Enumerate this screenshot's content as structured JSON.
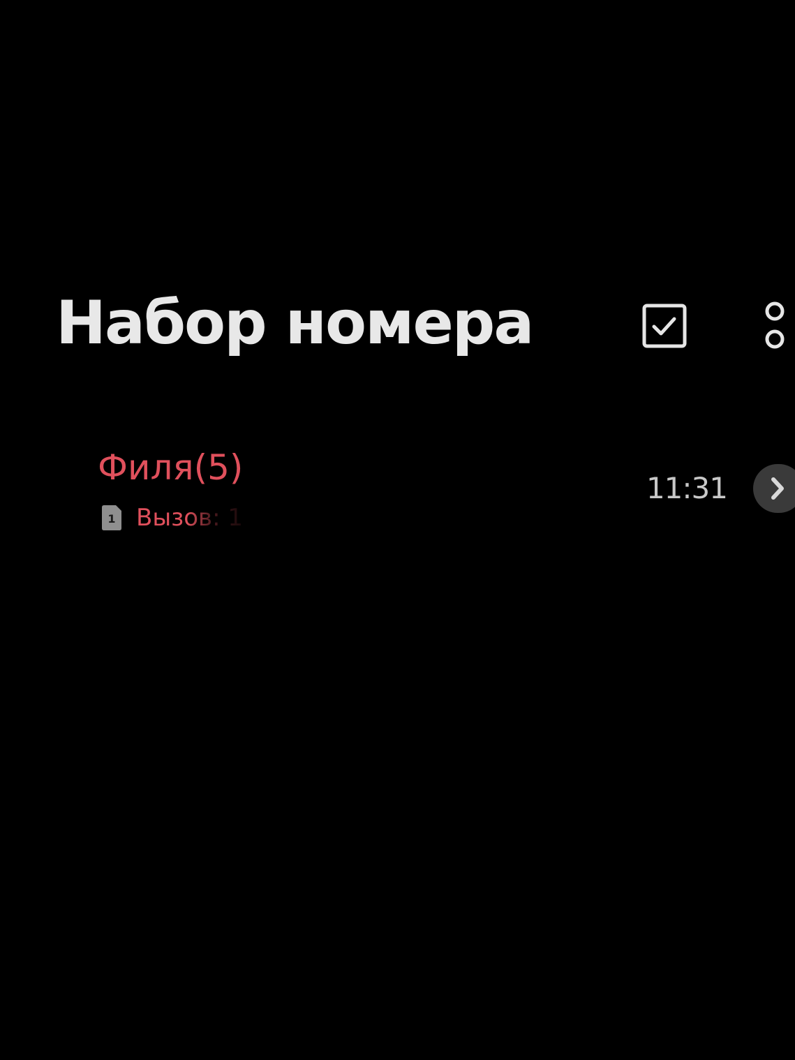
{
  "header": {
    "title": "Набор номера",
    "select_icon": "checkbox-checked-icon",
    "more_icon": "more-vertical-icon"
  },
  "recents": [
    {
      "name": "Филя(5)",
      "sim_icon": "sim-1-icon",
      "sim_slot": "1",
      "call_type": "Вызов: 1",
      "time": "11:31",
      "details_icon": "chevron-right-icon"
    }
  ],
  "colors": {
    "background": "#000000",
    "title": "#e8e8e8",
    "missed_call": "#e0505c",
    "secondary_text": "#c8c8c8"
  }
}
